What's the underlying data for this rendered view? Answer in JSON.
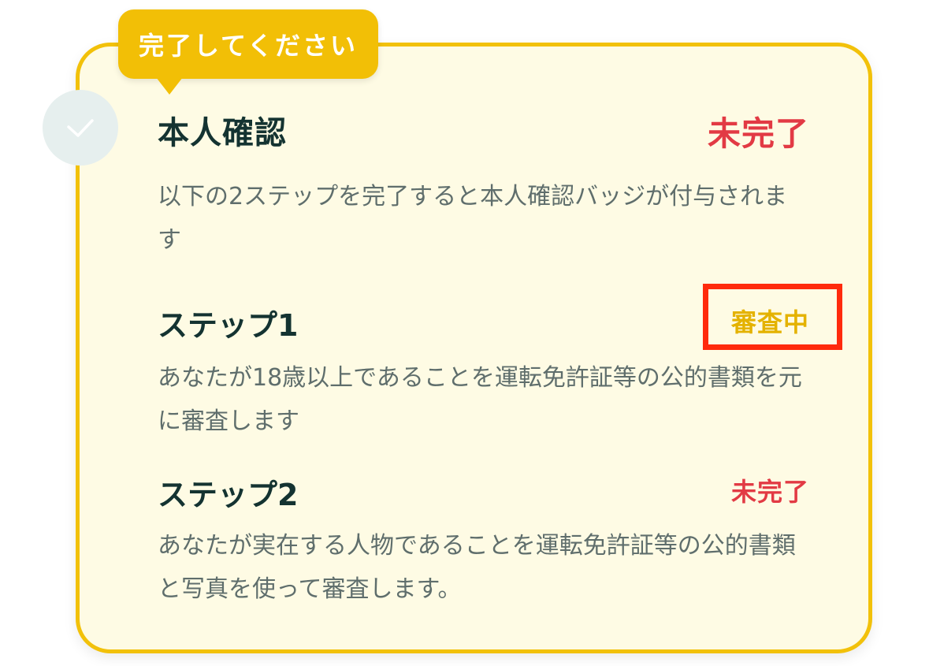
{
  "badge": {
    "label": "完了してください"
  },
  "verification": {
    "title": "本人確認",
    "status": "未完了",
    "description": "以下の2ステップを完了すると本人確認バッジが付与されます",
    "steps": [
      {
        "title": "ステップ1",
        "status": "審査中",
        "description": "あなたが18歳以上であることを運転免許証等の公的書類を元に審査します"
      },
      {
        "title": "ステップ2",
        "status": "未完了",
        "description": "あなたが実在する人物であることを運転免許証等の公的書類と写真を使って審査します。"
      }
    ]
  },
  "icons": {
    "check": "check-icon"
  },
  "colors": {
    "accent": "#f2bf06",
    "card_background": "#fefbe4",
    "incomplete": "#e23a44",
    "in_review": "#e4b200",
    "heading": "#143331",
    "body_text": "#5f6e6c",
    "check_circle": "#e6efee",
    "highlight": "#ff2a0c"
  }
}
